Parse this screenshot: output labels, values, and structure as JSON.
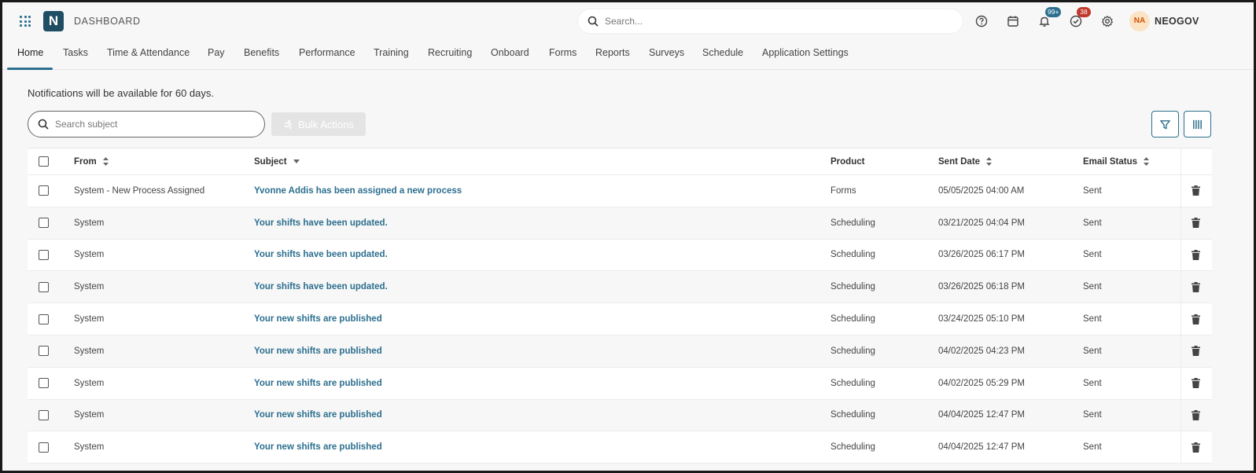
{
  "app": {
    "title": "DASHBOARD",
    "logo_letter": "N"
  },
  "search": {
    "placeholder": "Search..."
  },
  "badges": {
    "notifications": "99+",
    "tasks": "38"
  },
  "user": {
    "initials": "NA",
    "name": "NEOGOV"
  },
  "nav": {
    "tabs": [
      "Home",
      "Tasks",
      "Time & Attendance",
      "Pay",
      "Benefits",
      "Performance",
      "Training",
      "Recruiting",
      "Onboard",
      "Forms",
      "Reports",
      "Surveys",
      "Schedule",
      "Application Settings"
    ],
    "active": "Home"
  },
  "notice": "Notifications will be available for 60 days.",
  "subject_search": {
    "placeholder": "Search subject"
  },
  "bulk_actions": "Bulk Actions",
  "table": {
    "columns": {
      "from": "From",
      "subject": "Subject",
      "product": "Product",
      "sent_date": "Sent Date",
      "email_status": "Email Status"
    },
    "rows": [
      {
        "from": "System - New Process Assigned",
        "subject": "Yvonne Addis has been assigned a new process",
        "product": "Forms",
        "date": "05/05/2025 04:00 AM",
        "status": "Sent"
      },
      {
        "from": "System",
        "subject": "Your shifts have been updated.",
        "product": "Scheduling",
        "date": "03/21/2025 04:04 PM",
        "status": "Sent"
      },
      {
        "from": "System",
        "subject": "Your shifts have been updated.",
        "product": "Scheduling",
        "date": "03/26/2025 06:17 PM",
        "status": "Sent"
      },
      {
        "from": "System",
        "subject": "Your shifts have been updated.",
        "product": "Scheduling",
        "date": "03/26/2025 06:18 PM",
        "status": "Sent"
      },
      {
        "from": "System",
        "subject": "Your new shifts are published",
        "product": "Scheduling",
        "date": "03/24/2025 05:10 PM",
        "status": "Sent"
      },
      {
        "from": "System",
        "subject": "Your new shifts are published",
        "product": "Scheduling",
        "date": "04/02/2025 04:23 PM",
        "status": "Sent"
      },
      {
        "from": "System",
        "subject": "Your new shifts are published",
        "product": "Scheduling",
        "date": "04/02/2025 05:29 PM",
        "status": "Sent"
      },
      {
        "from": "System",
        "subject": "Your new shifts are published",
        "product": "Scheduling",
        "date": "04/04/2025 12:47 PM",
        "status": "Sent"
      },
      {
        "from": "System",
        "subject": "Your new shifts are published",
        "product": "Scheduling",
        "date": "04/04/2025 12:47 PM",
        "status": "Sent"
      }
    ]
  },
  "colors": {
    "accent": "#2c6f8e",
    "badge_red": "#c0392b",
    "avatar_bg": "#fbe3c5"
  }
}
